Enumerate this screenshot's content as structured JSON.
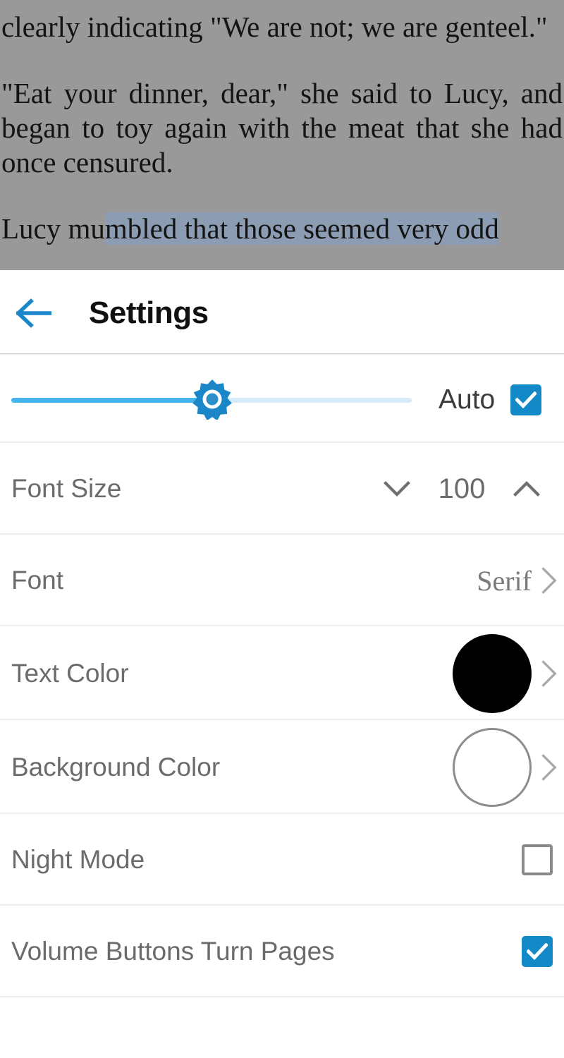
{
  "reader": {
    "paragraphs": [
      {
        "text": "clearly indicating \"We are not; we are genteel.\""
      },
      {
        "text": "\"Eat your dinner, dear,\" she said to Lucy, and began to toy again with the meat that she had once censured."
      }
    ],
    "partial_line_prefix": "Lucy mu",
    "partial_line_selected": "mbled that those seemed very odd",
    "selection_color": "#8b9cb3",
    "dim_overlay_color": "#999999"
  },
  "header": {
    "back_icon": "arrow-left-icon",
    "title": "Settings",
    "accent_color": "#1389c8"
  },
  "settings": {
    "brightness": {
      "name": "Brightness",
      "thumb_icon": "brightness-icon",
      "value_percent": 48,
      "track_active_color": "#43b4ec",
      "track_inactive_color": "#d6ecfa",
      "auto_label": "Auto",
      "auto_checked": true
    },
    "rows": [
      {
        "id": "font-size",
        "label": "Font Size",
        "type": "stepper",
        "decrement_icon": "chevron-down-icon",
        "increment_icon": "chevron-up-icon",
        "value": "100"
      },
      {
        "id": "font",
        "label": "Font",
        "type": "navigate",
        "value": "Serif",
        "chevron_icon": "chevron-right-icon"
      },
      {
        "id": "text-color",
        "label": "Text Color",
        "type": "color",
        "color": "#000000",
        "chevron_icon": "chevron-right-icon"
      },
      {
        "id": "background-color",
        "label": "Background Color",
        "type": "color",
        "color": "#ffffff",
        "chevron_icon": "chevron-right-icon"
      },
      {
        "id": "night-mode",
        "label": "Night Mode",
        "type": "checkbox",
        "checked": false
      },
      {
        "id": "volume-buttons-turn-pages",
        "label": "Volume Buttons Turn Pages",
        "type": "checkbox",
        "checked": true
      }
    ]
  }
}
